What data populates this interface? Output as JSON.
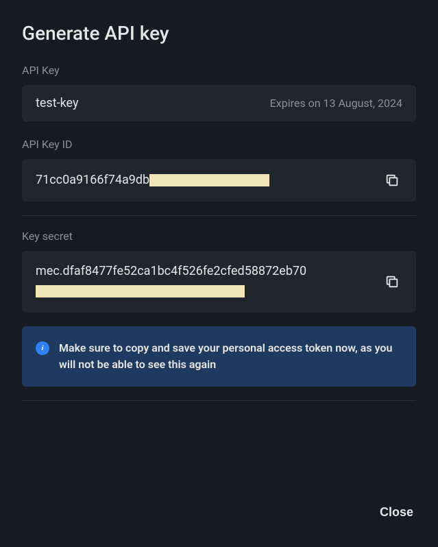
{
  "modal": {
    "title": "Generate API key"
  },
  "apiKey": {
    "label": "API Key",
    "name": "test-key",
    "expires": "Expires on 13 August, 2024"
  },
  "apiKeyId": {
    "label": "API Key ID",
    "visiblePrefix": "71cc0a9166f74a9db"
  },
  "keySecret": {
    "label": "Key secret",
    "visiblePrefix": "mec.dfaf8477fe52ca1bc4f526fe2cfed58872eb70"
  },
  "info": {
    "message": "Make sure to copy and save your personal access token now, as you will not be able to see this again"
  },
  "actions": {
    "close": "Close"
  }
}
